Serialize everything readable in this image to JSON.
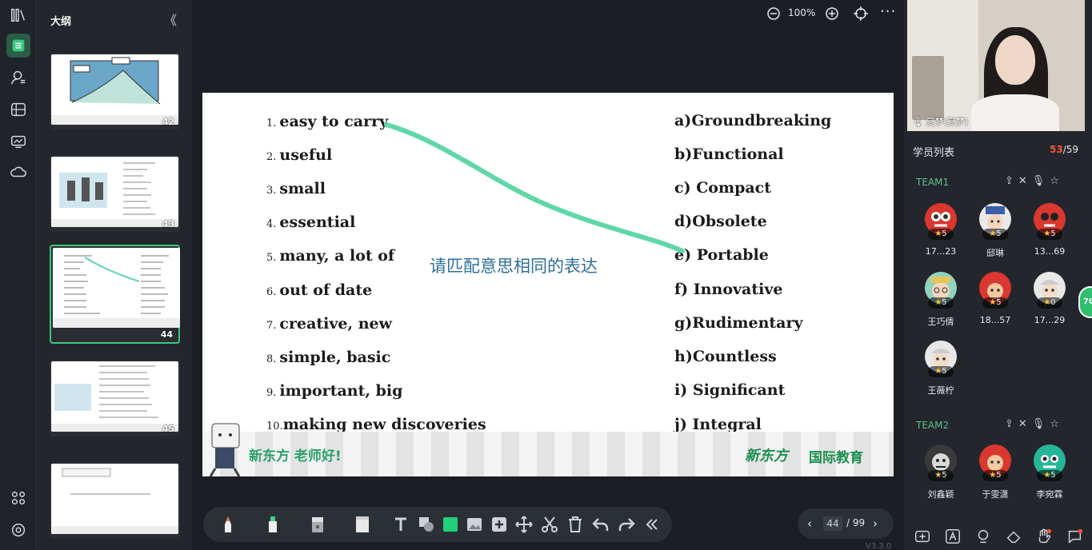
{
  "rail": {
    "items": [
      {
        "name": "books-icon"
      },
      {
        "name": "outline-icon",
        "active": true
      },
      {
        "name": "user-list-icon"
      },
      {
        "name": "grid-calendar-icon"
      },
      {
        "name": "monitor-icon"
      },
      {
        "name": "cloud-icon"
      },
      {
        "name": "apps-icon"
      },
      {
        "name": "settings-icon"
      }
    ]
  },
  "outline": {
    "title": "大纲",
    "collapse": "《",
    "thumbs": [
      {
        "num": "42",
        "selected": false
      },
      {
        "num": "43",
        "selected": false
      },
      {
        "num": "44",
        "selected": true
      },
      {
        "num": "45",
        "selected": false
      },
      {
        "num": "",
        "selected": false
      }
    ]
  },
  "topbar": {
    "zoom": "100%",
    "more": "···"
  },
  "slide": {
    "left_items": [
      {
        "n": "1.",
        "text": "easy to carry"
      },
      {
        "n": "2.",
        "text": "useful"
      },
      {
        "n": "3.",
        "text": "small"
      },
      {
        "n": "4.",
        "text": "essential"
      },
      {
        "n": "5.",
        "text": "many, a lot of"
      },
      {
        "n": "6.",
        "text": "out of date"
      },
      {
        "n": "7.",
        "text": "creative, new"
      },
      {
        "n": "8.",
        "text": "simple, basic"
      },
      {
        "n": "9.",
        "text": "important, big"
      },
      {
        "n": "10.",
        "text": "making new discoveries"
      }
    ],
    "right_items": [
      {
        "n": "a)",
        "text": "Groundbreaking"
      },
      {
        "n": "b)",
        "text": "Functional"
      },
      {
        "n": "c)",
        "text": "Compact"
      },
      {
        "n": "d)",
        "text": "Obsolete"
      },
      {
        "n": "e)",
        "text": "Portable"
      },
      {
        "n": "f)",
        "text": "Innovative"
      },
      {
        "n": "g)",
        "text": "Rudimentary"
      },
      {
        "n": "h)",
        "text": "Countless"
      },
      {
        "n": "i)",
        "text": "Significant"
      },
      {
        "n": "j)",
        "text": "Integral"
      }
    ],
    "prompt": "请匹配意思相同的表达",
    "banner_left": "新东方 老师好!",
    "brand": "新东方",
    "brand_sub": "国际教育",
    "line_color": "#5fd7a6"
  },
  "toolbar": {
    "tools": [
      "marker-orange-icon",
      "highlighter-green-icon",
      "eraser-grey-icon",
      "eraser-board-icon",
      "text-icon",
      "shape-icon",
      "color-square-icon",
      "image-icon",
      "add-icon",
      "move-icon",
      "scissors-icon",
      "delete-icon",
      "undo-icon",
      "redo-icon",
      "collapse-left-icon"
    ]
  },
  "pager": {
    "current": "44",
    "separator": "/ 99",
    "prev": "‹",
    "next": "›"
  },
  "version": "V3.3.0",
  "right": {
    "video_caption": "夏梦(夏梦)",
    "roster_title": "学员列表",
    "online": "53",
    "total": "/59",
    "teams": [
      {
        "name": "TEAM1",
        "members": [
          {
            "name": "17...23",
            "stars": "5",
            "color": "#d9372f"
          },
          {
            "name": "邸琳",
            "stars": "5",
            "color": "#f0f0f0"
          },
          {
            "name": "13...69",
            "stars": "5",
            "color": "#d9372f"
          },
          {
            "name": "王巧倩",
            "stars": "5",
            "color": "#8fd3c0"
          },
          {
            "name": "18...57",
            "stars": "5",
            "color": "#d9372f"
          },
          {
            "name": "17...29",
            "stars": "0",
            "color": "#e8e8e8"
          },
          {
            "name": "王薇柠",
            "stars": "5",
            "color": "#e8e8e8"
          }
        ]
      },
      {
        "name": "TEAM2",
        "members": [
          {
            "name": "刘鑫颖",
            "stars": "5",
            "color": "#3a3a3a"
          },
          {
            "name": "于雯潇",
            "stars": "5",
            "color": "#d9372f"
          },
          {
            "name": "李宛霖",
            "stars": "5",
            "color": "#27b59a"
          }
        ]
      }
    ],
    "float_badge": "70"
  }
}
